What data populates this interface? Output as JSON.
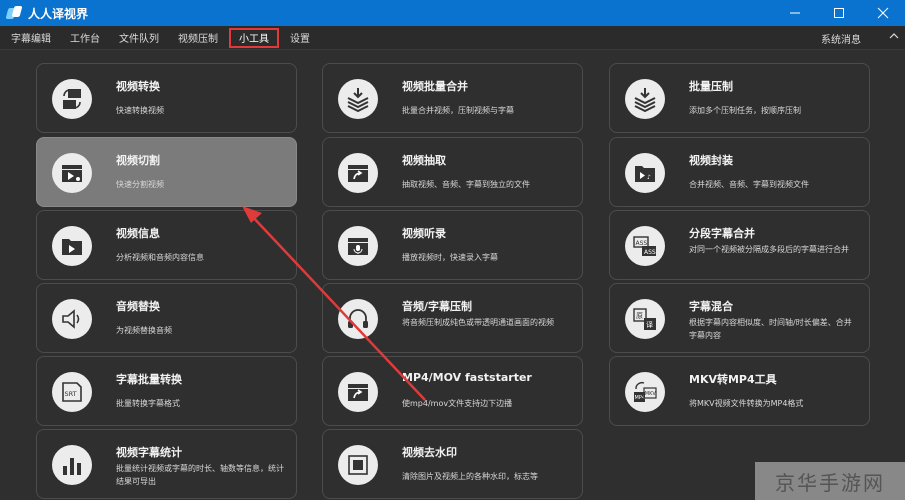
{
  "window": {
    "title": "人人译视界",
    "controls": [
      "minimize-icon",
      "maximize-icon",
      "close-icon"
    ]
  },
  "menu": {
    "items": [
      "字幕编辑",
      "工作台",
      "文件队列",
      "视频压制",
      "小工具",
      "设置"
    ],
    "active": "小工具",
    "system_message": "系统消息"
  },
  "tools": [
    {
      "title": "视频转换",
      "desc": "快速转换视频",
      "icon": "video-convert-icon"
    },
    {
      "title": "视频批量合并",
      "desc": "批量合并视频，压制视频与字幕",
      "icon": "batch-merge-icon"
    },
    {
      "title": "批量压制",
      "desc": "添加多个压制任务，按顺序压制",
      "icon": "batch-compress-icon"
    },
    {
      "title": "视频切割",
      "desc": "快速分割视频",
      "icon": "video-cut-icon"
    },
    {
      "title": "视频抽取",
      "desc": "抽取视频、音频、字幕到独立的文件",
      "icon": "video-extract-icon"
    },
    {
      "title": "视频封装",
      "desc": "合并视频、音频、字幕到视频文件",
      "icon": "video-package-icon"
    },
    {
      "title": "视频信息",
      "desc": "分析视频和音频内容信息",
      "icon": "video-info-icon"
    },
    {
      "title": "视频听录",
      "desc": "播放视频时，快速录入字幕",
      "icon": "video-transcribe-icon"
    },
    {
      "title": "分段字幕合并",
      "desc": "对同一个视频被分隔成多段后的字幕进行合并",
      "icon": "subtitle-merge-icon"
    },
    {
      "title": "音频替换",
      "desc": "为视频替换音频",
      "icon": "audio-replace-icon"
    },
    {
      "title": "音频/字幕压制",
      "desc": "将音频压制成纯色或带透明通道画面的视频",
      "icon": "audio-subtitle-compress-icon"
    },
    {
      "title": "字幕混合",
      "desc": "根据字幕内容相似度、时间轴/时长偏差、合并字幕内容",
      "icon": "subtitle-mix-icon"
    },
    {
      "title": "字幕批量转换",
      "desc": "批量转换字幕格式",
      "icon": "subtitle-convert-icon"
    },
    {
      "title": "MP4/MOV faststarter",
      "desc": "使mp4/mov文件支持边下边播",
      "icon": "faststarter-icon"
    },
    {
      "title": "MKV转MP4工具",
      "desc": "将MKV视频文件转换为MP4格式",
      "icon": "mkv-to-mp4-icon"
    },
    {
      "title": "视频字幕统计",
      "desc": "批量统计视频或字幕的时长、轴数等信息，统计结果可导出",
      "icon": "subtitle-stats-icon"
    },
    {
      "title": "视频去水印",
      "desc": "清除图片及视频上的各种水印，标志等",
      "icon": "watermark-remove-icon"
    }
  ],
  "selected_tool": "视频切割",
  "annotation": {
    "color": "#e03a3a"
  },
  "overlay_watermark": "京华手游网"
}
